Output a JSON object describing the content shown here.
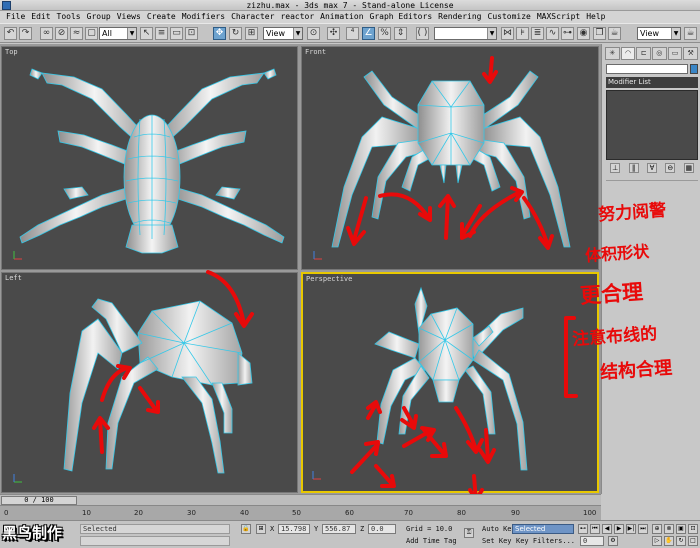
{
  "window": {
    "title": "zizhu.max - 3ds max 7  - Stand-alone License"
  },
  "menu": [
    "File",
    "Edit",
    "Tools",
    "Group",
    "Views",
    "Create",
    "Modifiers",
    "Character",
    "reactor",
    "Animation",
    "Graph Editors",
    "Rendering",
    "Customize",
    "MAXScript",
    "Help"
  ],
  "toolbar": {
    "selection_filter": "All",
    "ref_coord": "View",
    "named_selection": "",
    "view_combo_right": "View"
  },
  "viewports": {
    "top": "Top",
    "front": "Front",
    "left": "Left",
    "perspective": "Perspective"
  },
  "command_panel": {
    "modifier_list": "Modifier List"
  },
  "annotations": {
    "line1": "努力阅警",
    "line2": "体积形状",
    "line3": "更合理",
    "line4": "注意布线的",
    "line5": "结构合理"
  },
  "timeline": {
    "frame_counter": "0 / 100",
    "ticks": [
      "0",
      "10",
      "20",
      "30",
      "40",
      "50",
      "60",
      "70",
      "80",
      "90",
      "100"
    ]
  },
  "status": {
    "selected_left": "Selected",
    "x_label": "X",
    "x_value": "15.798",
    "y_label": "Y",
    "y_value": "556.87",
    "z_label": "Z",
    "z_value": "0.0",
    "grid": "Grid = 10.0",
    "add_time_tag": "Add Time Tag",
    "auto_key": "Auto Key",
    "auto_key_combo": "Selected",
    "set_key": "Set Key",
    "key_filters": "Key Filters...",
    "frame_value": "0"
  },
  "stamp": {
    "text": "黑鸟制作"
  },
  "colors": {
    "viewport_bg": "#4a4a4a",
    "active_border": "#e8c800",
    "annotation_red": "#e80a0a",
    "wire_blue": "#35c8e8"
  }
}
